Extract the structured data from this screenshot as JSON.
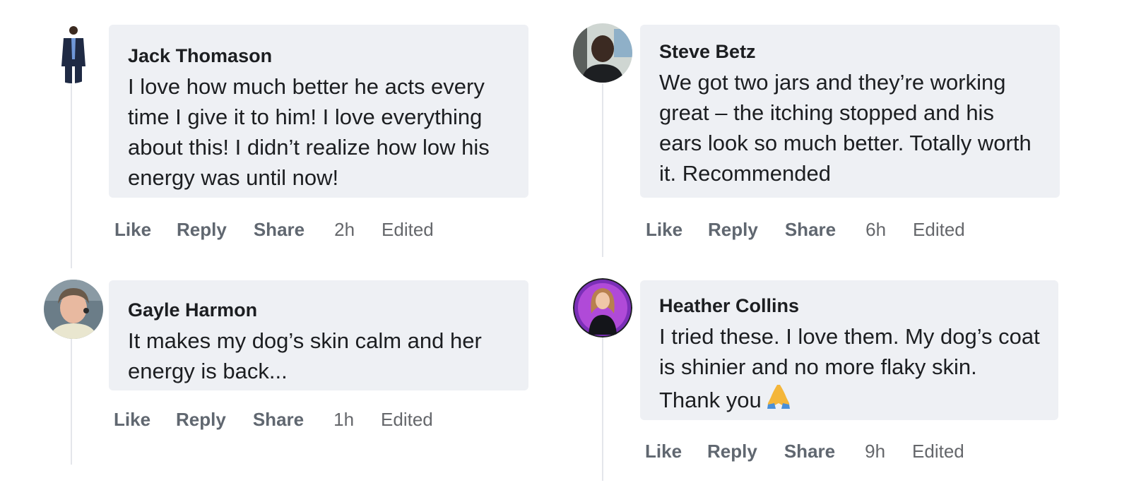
{
  "comments": [
    {
      "author": "Jack Thomason",
      "text": "I love how much better he acts every time I give it to him! I love everything about this! I didn’t realize how low his energy was until now!",
      "time": "2h"
    },
    {
      "author": "Steve Betz",
      "text": "We got two jars and they’re working great – the itching stopped and his ears look so much better. Totally worth it. Recommended",
      "time": "6h"
    },
    {
      "author": "Gayle Harmon",
      "text": "It makes my dog’s skin calm and her energy is back...",
      "time": "1h"
    },
    {
      "author": "Heather Collins",
      "text": "I tried these. I love them. My dog’s coat is shinier and no more flaky skin. Thank you",
      "time": "9h",
      "emoji": "folded-hands-icon"
    }
  ],
  "actions": {
    "like": "Like",
    "reply": "Reply",
    "share": "Share",
    "edited": "Edited"
  },
  "colors": {
    "bubble": "#eef0f4",
    "action_text": "#606770",
    "thread_line": "#e4e6eb"
  }
}
